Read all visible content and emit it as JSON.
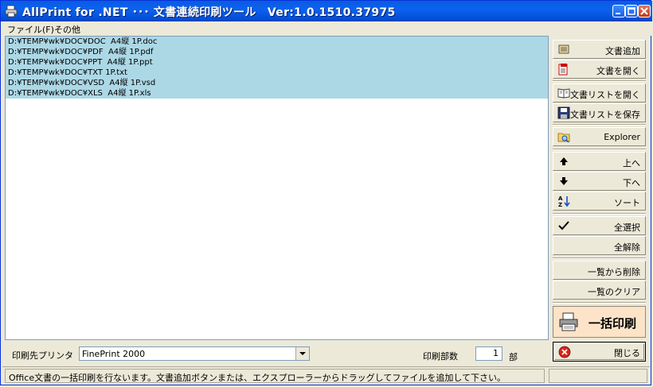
{
  "window": {
    "title": "AllPrint for .NET ･･･ 文書連続印刷ツール　Ver:1.0.1510.37975",
    "titlebar_color": "#0b62f0"
  },
  "menu": {
    "file": "ファイル(F)",
    "other": "その他"
  },
  "file_list": {
    "selection_color": "#acd8e6",
    "items": [
      "D:¥TEMP¥wk¥DOC¥DOC  A4縦 1P.doc",
      "D:¥TEMP¥wk¥DOC¥PDF  A4縦 1P.pdf",
      "D:¥TEMP¥wk¥DOC¥PPT  A4縦 1P.ppt",
      "D:¥TEMP¥wk¥DOC¥TXT 1P.txt",
      "D:¥TEMP¥wk¥DOC¥VSD  A4縦 1P.vsd",
      "D:¥TEMP¥wk¥DOC¥XLS  A4縦 1P.xls"
    ]
  },
  "buttons": {
    "add_doc": "文書追加",
    "open_doc": "文書を開く",
    "open_list": "文書リストを開く",
    "save_list": "文書リストを保存",
    "explorer": "Explorer",
    "up": "上へ",
    "down": "下へ",
    "sort": "ソート",
    "select_all": "全選択",
    "deselect_all": "全解除",
    "remove_from_list": "一覧から削除",
    "clear_list": "一覧のクリア",
    "batch_print": "一括印刷",
    "close": "閉じる"
  },
  "print_settings": {
    "printer_label": "印刷先プリンタ",
    "printer_value": "FinePrint 2000",
    "copies_label": "印刷部数",
    "copies_value": "1",
    "copies_unit": "部"
  },
  "status": {
    "text": "Office文書の一括印刷を行ないます。文書追加ボタンまたは、エクスプローラーからドラッグしてファイルを追加して下さい。"
  }
}
